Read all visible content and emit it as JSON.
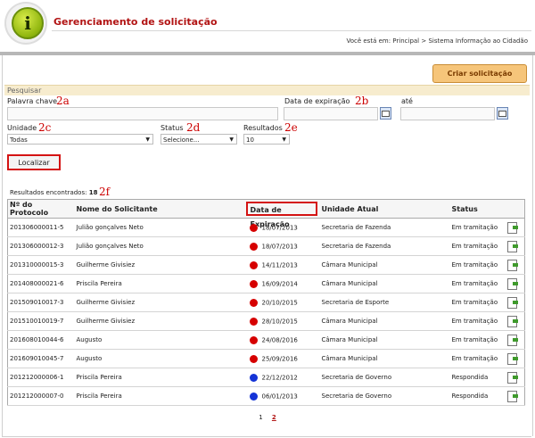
{
  "header": {
    "title": "Gerenciamento de solicitação",
    "breadcrumb": "Você está em: Principal > Sistema Informação ao Cidadão",
    "logo_letter": "i"
  },
  "actions": {
    "new_request": "Criar solicitação"
  },
  "search": {
    "section_title": "Pesquisar",
    "keyword_label": "Palavra chave",
    "expiry_label": "Data de expiração",
    "until_label": "até",
    "unit_label": "Unidade",
    "unit_value": "Todas",
    "status_label": "Status",
    "status_value": "Selecione...",
    "results_label": "Resultados",
    "results_value": "10",
    "submit_label": "Localizar"
  },
  "annotations": {
    "a": "2a",
    "b": "2b",
    "c": "2c",
    "d": "2d",
    "e": "2e",
    "f": "2f"
  },
  "results_count": {
    "label": "Resultados encontrados:",
    "value": "18"
  },
  "table": {
    "headers": [
      "Nº do Protocolo",
      "Nome do Solicitante",
      "Data de Expiração",
      "Unidade Atual",
      "Status"
    ],
    "rows": [
      {
        "protocol": "201306000011-5",
        "name": "Julião gonçalves Neto",
        "date": "18/07/2013",
        "dot": "red",
        "unit": "Secretaria de Fazenda",
        "status": "Em tramitação"
      },
      {
        "protocol": "201306000012-3",
        "name": "Julião gonçalves Neto",
        "date": "18/07/2013",
        "dot": "red",
        "unit": "Secretaria de Fazenda",
        "status": "Em tramitação"
      },
      {
        "protocol": "201310000015-3",
        "name": "Guilherme Givisiez",
        "date": "14/11/2013",
        "dot": "red",
        "unit": "Câmara Municipal",
        "status": "Em tramitação"
      },
      {
        "protocol": "201408000021-6",
        "name": "Priscila Pereira",
        "date": "16/09/2014",
        "dot": "red",
        "unit": "Câmara Municipal",
        "status": "Em tramitação"
      },
      {
        "protocol": "201509010017-3",
        "name": "Guilherme Givisiez",
        "date": "20/10/2015",
        "dot": "red",
        "unit": "Secretaria de Esporte",
        "status": "Em tramitação"
      },
      {
        "protocol": "201510010019-7",
        "name": "Guilherme Givisiez",
        "date": "28/10/2015",
        "dot": "red",
        "unit": "Câmara Municipal",
        "status": "Em tramitação"
      },
      {
        "protocol": "201608010044-6",
        "name": "Augusto",
        "date": "24/08/2016",
        "dot": "red",
        "unit": "Câmara Municipal",
        "status": "Em tramitação"
      },
      {
        "protocol": "201609010045-7",
        "name": "Augusto",
        "date": "25/09/2016",
        "dot": "red",
        "unit": "Câmara Municipal",
        "status": "Em tramitação"
      },
      {
        "protocol": "201212000006-1",
        "name": "Priscila Pereira",
        "date": "22/12/2012",
        "dot": "blue",
        "unit": "Secretaria de Governo",
        "status": "Respondida"
      },
      {
        "protocol": "201212000007-0",
        "name": "Priscila Pereira",
        "date": "06/01/2013",
        "dot": "blue",
        "unit": "Secretaria de Governo",
        "status": "Respondida"
      }
    ]
  },
  "pagination": {
    "pages": [
      "1",
      "2"
    ],
    "current": "2"
  },
  "colors": {
    "red": "#d60000",
    "blue": "#1433d6",
    "accent": "#b21414"
  }
}
